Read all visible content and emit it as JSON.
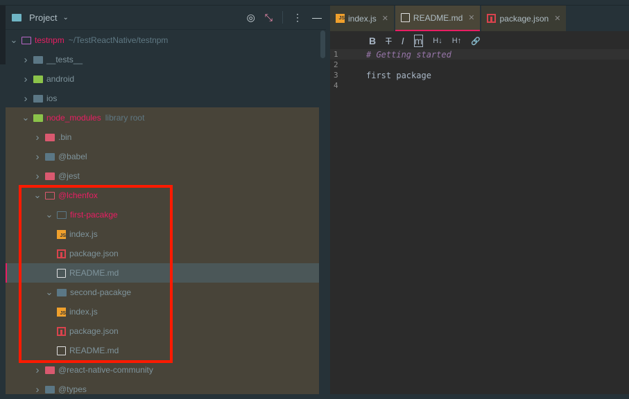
{
  "project": {
    "title": "Project",
    "tools": [
      "target-icon",
      "collapse-icon",
      "more-icon",
      "minimize-icon"
    ]
  },
  "tree": [
    {
      "label": "testnpm",
      "hint": "~/TestReactNative/testnpm",
      "depth": 0,
      "chev": "v",
      "icon": "op",
      "pink": true
    },
    {
      "label": "__tests__",
      "depth": 1,
      "chev": ">",
      "icon": "g"
    },
    {
      "label": "android",
      "depth": 1,
      "chev": ">",
      "icon": "green"
    },
    {
      "label": "ios",
      "depth": 1,
      "chev": ">",
      "icon": "g"
    },
    {
      "label": "node_modules",
      "hint": "library root",
      "depth": 1,
      "chev": "v",
      "icon": "green",
      "pink": true
    },
    {
      "label": ".bin",
      "depth": 2,
      "chev": ">",
      "icon": "r"
    },
    {
      "label": "@babel",
      "depth": 2,
      "chev": ">",
      "icon": "g"
    },
    {
      "label": "@jest",
      "depth": 2,
      "chev": ">",
      "icon": "r"
    },
    {
      "label": "@lchenfox",
      "depth": 2,
      "chev": "v",
      "icon": "o",
      "pink": true
    },
    {
      "label": "first-pacakge",
      "depth": 3,
      "chev": "v",
      "icon": "ob",
      "pink": true
    },
    {
      "label": "index.js",
      "depth": 4,
      "file": "js"
    },
    {
      "label": "package.json",
      "depth": 4,
      "file": "pj"
    },
    {
      "label": "README.md",
      "depth": 4,
      "file": "md"
    },
    {
      "label": "second-pacakge",
      "depth": 3,
      "chev": "v",
      "icon": "g"
    },
    {
      "label": "index.js",
      "depth": 4,
      "file": "js"
    },
    {
      "label": "package.json",
      "depth": 4,
      "file": "pj"
    },
    {
      "label": "README.md",
      "depth": 4,
      "file": "md"
    },
    {
      "label": "@react-native-community",
      "depth": 2,
      "chev": ">",
      "icon": "r"
    },
    {
      "label": "@types",
      "depth": 2,
      "chev": ">",
      "icon": "g"
    }
  ],
  "tabs": [
    {
      "label": "index.js",
      "file": "js"
    },
    {
      "label": "README.md",
      "file": "md",
      "active": true
    },
    {
      "label": "package.json",
      "file": "pj"
    }
  ],
  "md_toolbar": [
    "B",
    "T",
    "I",
    "m",
    "H↓",
    "H↑",
    "🔗"
  ],
  "lines": [
    {
      "n": "1",
      "text": "# Getting started",
      "h": true
    },
    {
      "n": "2",
      "text": ""
    },
    {
      "n": "3",
      "text": "first package"
    },
    {
      "n": "4",
      "text": ""
    }
  ]
}
